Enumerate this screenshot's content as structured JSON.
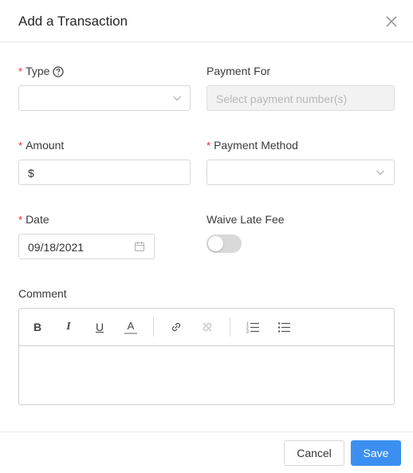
{
  "dialog": {
    "title": "Add a Transaction"
  },
  "fields": {
    "type": {
      "label": "Type",
      "value": ""
    },
    "payment_for": {
      "label": "Payment For",
      "placeholder": "Select payment number(s)"
    },
    "amount": {
      "label": "Amount",
      "prefix": "$",
      "value": ""
    },
    "payment_method": {
      "label": "Payment Method",
      "value": ""
    },
    "date": {
      "label": "Date",
      "value": "09/18/2021"
    },
    "waive_late_fee": {
      "label": "Waive Late Fee",
      "enabled": false
    },
    "comment": {
      "label": "Comment",
      "value": ""
    }
  },
  "toolbar": {
    "bold": "B",
    "italic": "I",
    "underline": "U",
    "font_color": "A"
  },
  "buttons": {
    "cancel": "Cancel",
    "save": "Save"
  },
  "colors": {
    "primary": "#3b8ff0",
    "required": "#f5222d",
    "toggle_off": "#d9d9d9"
  }
}
